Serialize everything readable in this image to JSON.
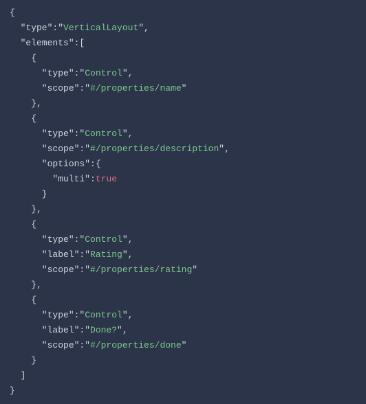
{
  "lines": [
    [
      {
        "cls": "punc",
        "t": "{"
      }
    ],
    [
      {
        "cls": "punc",
        "t": "  \""
      },
      {
        "cls": "key",
        "t": "type"
      },
      {
        "cls": "punc",
        "t": "\":\""
      },
      {
        "cls": "str",
        "t": "VerticalLayout"
      },
      {
        "cls": "punc",
        "t": "\","
      }
    ],
    [
      {
        "cls": "punc",
        "t": "  \""
      },
      {
        "cls": "key",
        "t": "elements"
      },
      {
        "cls": "punc",
        "t": "\":["
      }
    ],
    [
      {
        "cls": "punc",
        "t": "    {"
      }
    ],
    [
      {
        "cls": "punc",
        "t": "      \""
      },
      {
        "cls": "key",
        "t": "type"
      },
      {
        "cls": "punc",
        "t": "\":\""
      },
      {
        "cls": "str",
        "t": "Control"
      },
      {
        "cls": "punc",
        "t": "\","
      }
    ],
    [
      {
        "cls": "punc",
        "t": "      \""
      },
      {
        "cls": "key",
        "t": "scope"
      },
      {
        "cls": "punc",
        "t": "\":\""
      },
      {
        "cls": "str",
        "t": "#/properties/name"
      },
      {
        "cls": "punc",
        "t": "\""
      }
    ],
    [
      {
        "cls": "punc",
        "t": "    },"
      }
    ],
    [
      {
        "cls": "punc",
        "t": "    {"
      }
    ],
    [
      {
        "cls": "punc",
        "t": "      \""
      },
      {
        "cls": "key",
        "t": "type"
      },
      {
        "cls": "punc",
        "t": "\":\""
      },
      {
        "cls": "str",
        "t": "Control"
      },
      {
        "cls": "punc",
        "t": "\","
      }
    ],
    [
      {
        "cls": "punc",
        "t": "      \""
      },
      {
        "cls": "key",
        "t": "scope"
      },
      {
        "cls": "punc",
        "t": "\":\""
      },
      {
        "cls": "str",
        "t": "#/properties/description"
      },
      {
        "cls": "punc",
        "t": "\","
      }
    ],
    [
      {
        "cls": "punc",
        "t": "      \""
      },
      {
        "cls": "key",
        "t": "options"
      },
      {
        "cls": "punc",
        "t": "\":{"
      }
    ],
    [
      {
        "cls": "punc",
        "t": "        \""
      },
      {
        "cls": "key",
        "t": "multi"
      },
      {
        "cls": "punc",
        "t": "\":"
      },
      {
        "cls": "bool",
        "t": "true"
      }
    ],
    [
      {
        "cls": "punc",
        "t": "      }"
      }
    ],
    [
      {
        "cls": "punc",
        "t": "    },"
      }
    ],
    [
      {
        "cls": "punc",
        "t": "    {"
      }
    ],
    [
      {
        "cls": "punc",
        "t": "      \""
      },
      {
        "cls": "key",
        "t": "type"
      },
      {
        "cls": "punc",
        "t": "\":\""
      },
      {
        "cls": "str",
        "t": "Control"
      },
      {
        "cls": "punc",
        "t": "\","
      }
    ],
    [
      {
        "cls": "punc",
        "t": "      \""
      },
      {
        "cls": "key",
        "t": "label"
      },
      {
        "cls": "punc",
        "t": "\":\""
      },
      {
        "cls": "str",
        "t": "Rating"
      },
      {
        "cls": "punc",
        "t": "\","
      }
    ],
    [
      {
        "cls": "punc",
        "t": "      \""
      },
      {
        "cls": "key",
        "t": "scope"
      },
      {
        "cls": "punc",
        "t": "\":\""
      },
      {
        "cls": "str",
        "t": "#/properties/rating"
      },
      {
        "cls": "punc",
        "t": "\""
      }
    ],
    [
      {
        "cls": "punc",
        "t": "    },"
      }
    ],
    [
      {
        "cls": "punc",
        "t": "    {"
      }
    ],
    [
      {
        "cls": "punc",
        "t": "      \""
      },
      {
        "cls": "key",
        "t": "type"
      },
      {
        "cls": "punc",
        "t": "\":\""
      },
      {
        "cls": "str",
        "t": "Control"
      },
      {
        "cls": "punc",
        "t": "\","
      }
    ],
    [
      {
        "cls": "punc",
        "t": "      \""
      },
      {
        "cls": "key",
        "t": "label"
      },
      {
        "cls": "punc",
        "t": "\":\""
      },
      {
        "cls": "str",
        "t": "Done?"
      },
      {
        "cls": "punc",
        "t": "\","
      }
    ],
    [
      {
        "cls": "punc",
        "t": "      \""
      },
      {
        "cls": "key",
        "t": "scope"
      },
      {
        "cls": "punc",
        "t": "\":\""
      },
      {
        "cls": "str",
        "t": "#/properties/done"
      },
      {
        "cls": "punc",
        "t": "\""
      }
    ],
    [
      {
        "cls": "punc",
        "t": "    }"
      }
    ],
    [
      {
        "cls": "punc",
        "t": "  ]"
      }
    ],
    [
      {
        "cls": "punc",
        "t": "}"
      }
    ]
  ]
}
